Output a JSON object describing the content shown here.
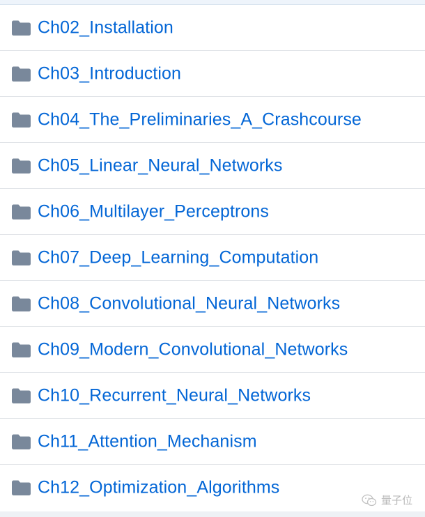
{
  "folders": [
    {
      "name": "Ch02_Installation",
      "icon": "folder-icon"
    },
    {
      "name": "Ch03_Introduction",
      "icon": "folder-icon"
    },
    {
      "name": "Ch04_The_Preliminaries_A_Crashcourse",
      "icon": "folder-icon"
    },
    {
      "name": "Ch05_Linear_Neural_Networks",
      "icon": "folder-icon"
    },
    {
      "name": "Ch06_Multilayer_Perceptrons",
      "icon": "folder-icon"
    },
    {
      "name": "Ch07_Deep_Learning_Computation",
      "icon": "folder-icon"
    },
    {
      "name": "Ch08_Convolutional_Neural_Networks",
      "icon": "folder-icon"
    },
    {
      "name": "Ch09_Modern_Convolutional_Networks",
      "icon": "folder-icon"
    },
    {
      "name": "Ch10_Recurrent_Neural_Networks",
      "icon": "folder-icon"
    },
    {
      "name": "Ch11_Attention_Mechanism",
      "icon": "folder-icon"
    },
    {
      "name": "Ch12_Optimization_Algorithms",
      "icon": "folder-icon"
    }
  ],
  "watermark": {
    "text": "量子位",
    "icon": "wechat-icon"
  },
  "colors": {
    "link": "#0366d6",
    "folder_icon": "#79889b",
    "divider": "#e1e4e8"
  }
}
